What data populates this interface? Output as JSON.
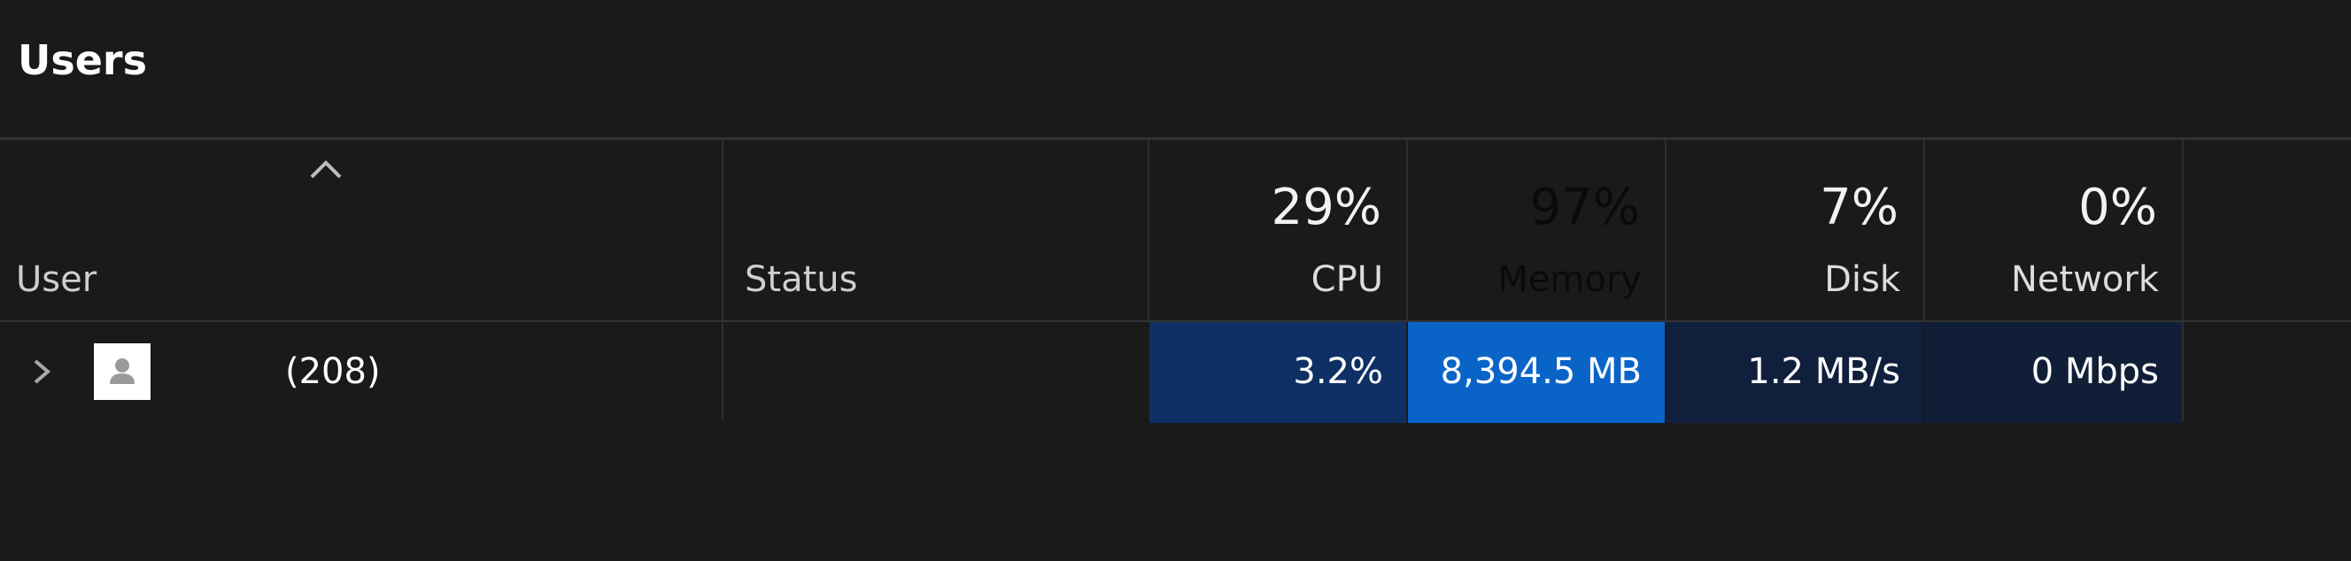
{
  "page": {
    "title": "Users"
  },
  "columns": {
    "user": {
      "label": "User"
    },
    "status": {
      "label": "Status"
    },
    "cpu": {
      "percent": "29%",
      "label": "CPU"
    },
    "memory": {
      "percent": "97%",
      "label": "Memory"
    },
    "disk": {
      "percent": "7%",
      "label": "Disk"
    },
    "network": {
      "percent": "0%",
      "label": "Network"
    }
  },
  "rows": [
    {
      "user": "(208)",
      "status": "",
      "cpu": "3.2%",
      "memory": "8,394.5 MB",
      "disk": "1.2 MB/s",
      "network": "0 Mbps"
    }
  ],
  "colors": {
    "background": "#1a1a1a",
    "cpu_heat": "#0f3064",
    "memory_heat": "#0a64c8",
    "memory_header_heat": "#1a1a1a",
    "disk_heat": "#101f3c",
    "network_heat": "#111e37"
  },
  "icons": {
    "sort": "chevron-up-icon",
    "expand": "chevron-right-icon",
    "avatar": "user-avatar-icon"
  }
}
